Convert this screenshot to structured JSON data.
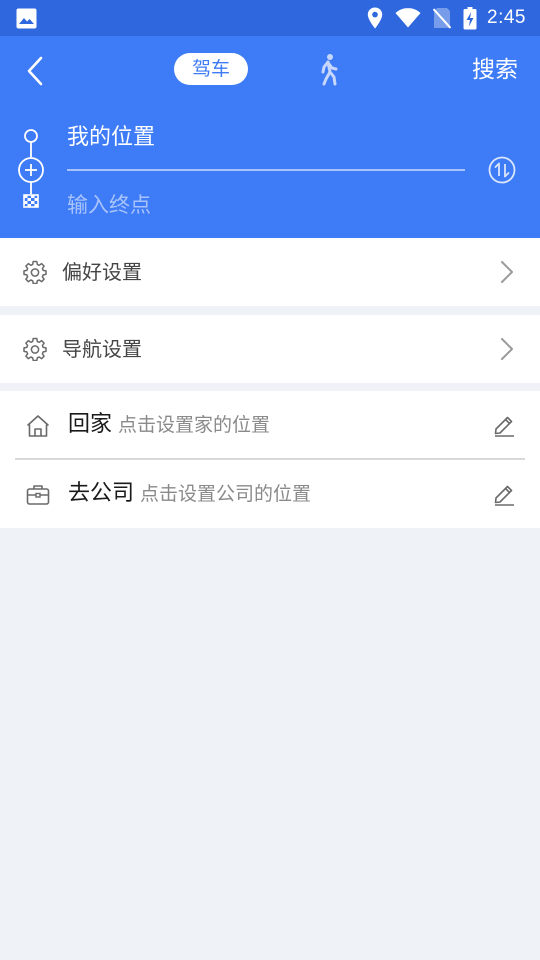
{
  "status_bar": {
    "time": "2:45",
    "icons": [
      "gallery-icon",
      "location-icon",
      "wifi-icon",
      "no-sim-icon",
      "battery-charging-icon"
    ]
  },
  "header": {
    "back_icon": "back-chevron-icon",
    "modes": [
      {
        "label": "驾车",
        "selected": true
      },
      {
        "icon": "walk-icon",
        "selected": false
      }
    ],
    "search_label": "搜索",
    "start_value": "我的位置",
    "destination_placeholder": "输入终点",
    "swap_icon": "swap-icon"
  },
  "settings": [
    {
      "label": "偏好设置",
      "icon": "gear-icon"
    },
    {
      "label": "导航设置",
      "icon": "gear-icon"
    }
  ],
  "places": [
    {
      "title": "回家",
      "hint": "点击设置家的位置",
      "icon": "home-icon"
    },
    {
      "title": "去公司",
      "hint": "点击设置公司的位置",
      "icon": "briefcase-icon"
    }
  ],
  "colors": {
    "status_bar": "#2f67df",
    "header": "#3e7bf7",
    "page_background": "#eff2f7",
    "accent": "#3e7bf7"
  }
}
